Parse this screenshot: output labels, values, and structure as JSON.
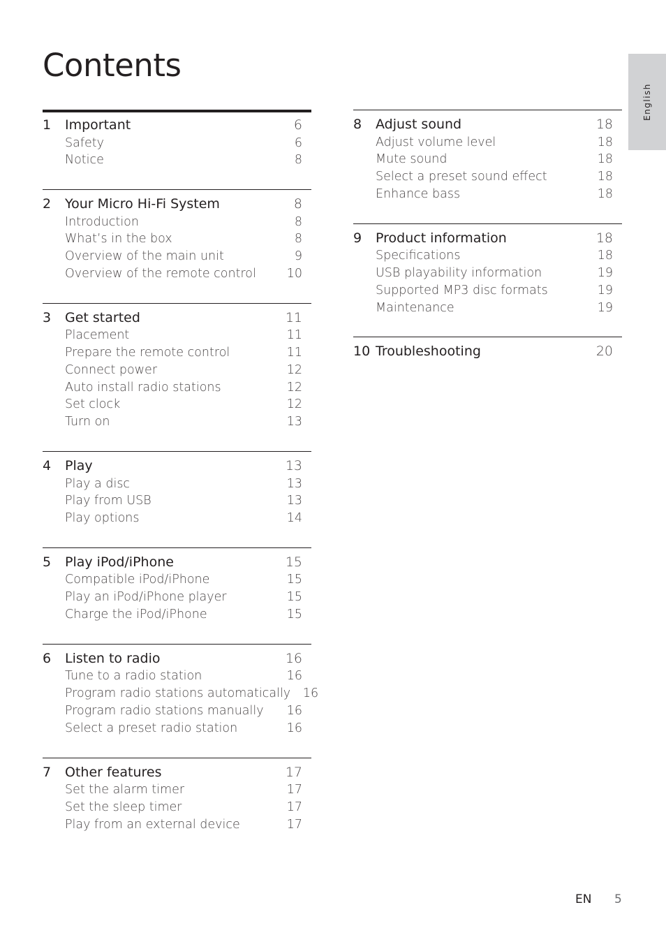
{
  "page_title": "Contents",
  "language_tab": "English",
  "footer": {
    "language_code": "EN",
    "page_number": "5"
  },
  "left_column": [
    {
      "number": "1",
      "title": "Important",
      "page": "6",
      "items": [
        {
          "label": "Safety",
          "page": "6"
        },
        {
          "label": "Notice",
          "page": "8"
        }
      ]
    },
    {
      "number": "2",
      "title": "Your Micro Hi-Fi System",
      "page": "8",
      "items": [
        {
          "label": "Introduction",
          "page": "8"
        },
        {
          "label": "What’s in the box",
          "page": "8"
        },
        {
          "label": "Overview of the main unit",
          "page": "9"
        },
        {
          "label": "Overview of the remote control",
          "page": "10"
        }
      ]
    },
    {
      "number": "3",
      "title": "Get started",
      "page": "11",
      "items": [
        {
          "label": "Placement",
          "page": "11"
        },
        {
          "label": "Prepare the remote control",
          "page": "11"
        },
        {
          "label": "Connect power",
          "page": "12"
        },
        {
          "label": "Auto install radio stations",
          "page": "12"
        },
        {
          "label": "Set clock",
          "page": "12"
        },
        {
          "label": "Turn on",
          "page": "13"
        }
      ]
    },
    {
      "number": "4",
      "title": "Play",
      "page": "13",
      "items": [
        {
          "label": "Play a disc",
          "page": "13"
        },
        {
          "label": "Play from USB",
          "page": "13"
        },
        {
          "label": "Play options",
          "page": "14"
        }
      ]
    },
    {
      "number": "5",
      "title": "Play iPod/iPhone",
      "page": "15",
      "items": [
        {
          "label": "Compatible iPod/iPhone",
          "page": "15"
        },
        {
          "label": "Play an iPod/iPhone player",
          "page": "15"
        },
        {
          "label": "Charge the iPod/iPhone",
          "page": "15"
        }
      ]
    },
    {
      "number": "6",
      "title": "Listen to radio",
      "page": "16",
      "items": [
        {
          "label": "Tune to a radio station",
          "page": "16"
        },
        {
          "label": "Program radio stations automatically",
          "page": "16"
        },
        {
          "label": "Program radio stations manually",
          "page": "16"
        },
        {
          "label": "Select a preset radio station",
          "page": "16"
        }
      ]
    },
    {
      "number": "7",
      "title": "Other features",
      "page": "17",
      "items": [
        {
          "label": "Set the alarm timer",
          "page": "17"
        },
        {
          "label": "Set the sleep timer",
          "page": "17"
        },
        {
          "label": "Play from an external device",
          "page": "17"
        }
      ]
    }
  ],
  "right_column": [
    {
      "number": "8",
      "title": "Adjust sound",
      "page": "18",
      "items": [
        {
          "label": "Adjust volume level",
          "page": "18"
        },
        {
          "label": "Mute sound",
          "page": "18"
        },
        {
          "label": "Select a preset sound effect",
          "page": "18"
        },
        {
          "label": "Enhance bass",
          "page": "18"
        }
      ]
    },
    {
      "number": "9",
      "title": "Product information",
      "page": "18",
      "items": [
        {
          "label": "Specifications",
          "page": "18"
        },
        {
          "label": "USB playability information",
          "page": "19"
        },
        {
          "label": "Supported MP3 disc formats",
          "page": "19"
        },
        {
          "label": "Maintenance",
          "page": "19"
        }
      ]
    },
    {
      "number": "10",
      "title": "Troubleshooting",
      "page": "20",
      "items": []
    }
  ]
}
